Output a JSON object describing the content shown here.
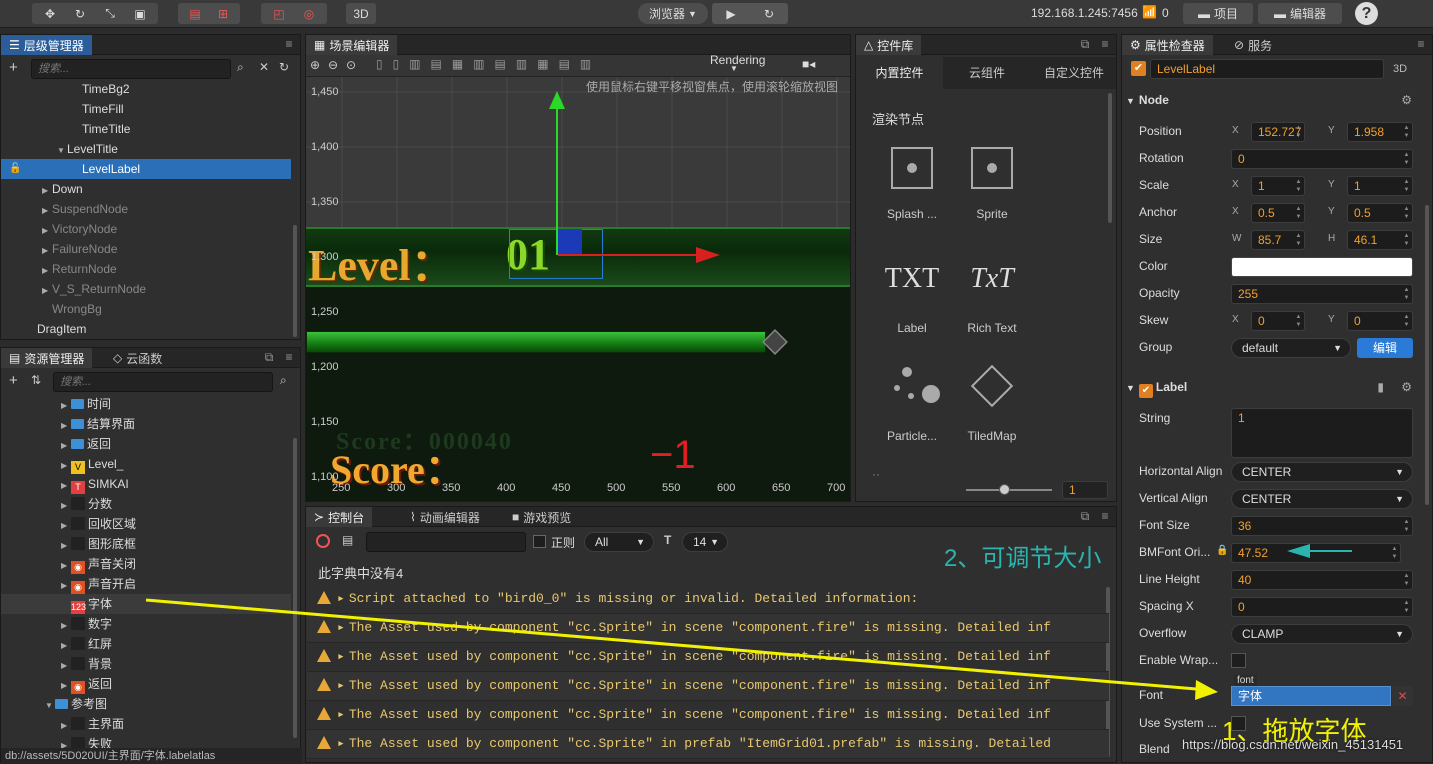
{
  "toolbar": {
    "browser_label": "浏览器",
    "three_d": "3D",
    "ip": "192.168.1.245:7456",
    "wifi_count": "0",
    "project_btn": "项目",
    "editor_btn": "编辑器",
    "help": "?"
  },
  "hierarchy": {
    "tab": "层级管理器",
    "search_placeholder": "搜索...",
    "rows": [
      {
        "label": "TimeBg2",
        "indent": 85,
        "state": "normal",
        "arrow": ""
      },
      {
        "label": "TimeFill",
        "indent": 85,
        "state": "normal",
        "arrow": ""
      },
      {
        "label": "TimeTitle",
        "indent": 85,
        "state": "normal",
        "arrow": ""
      },
      {
        "label": "LevelTitle",
        "indent": 70,
        "state": "normal",
        "arrow": "▼"
      },
      {
        "label": "LevelLabel",
        "indent": 85,
        "state": "selected",
        "arrow": ""
      },
      {
        "label": "Down",
        "indent": 55,
        "state": "normal",
        "arrow": "▶"
      },
      {
        "label": "SuspendNode",
        "indent": 55,
        "state": "dim",
        "arrow": "▶"
      },
      {
        "label": "VictoryNode",
        "indent": 55,
        "state": "dim",
        "arrow": "▶"
      },
      {
        "label": "FailureNode",
        "indent": 55,
        "state": "dim",
        "arrow": "▶"
      },
      {
        "label": "ReturnNode",
        "indent": 55,
        "state": "dim",
        "arrow": "▶"
      },
      {
        "label": "V_S_ReturnNode",
        "indent": 55,
        "state": "dim",
        "arrow": "▶"
      },
      {
        "label": "WrongBg",
        "indent": 55,
        "state": "dim",
        "arrow": ""
      },
      {
        "label": "DragItem",
        "indent": 40,
        "state": "normal",
        "arrow": ""
      }
    ]
  },
  "assets": {
    "tab": "资源管理器",
    "tab2": "云函数",
    "search_placeholder": "搜索...",
    "rows": [
      {
        "label": "时间",
        "icon": "folder",
        "indent": 74
      },
      {
        "label": "结算界面",
        "icon": "folder",
        "indent": 74
      },
      {
        "label": "返回",
        "icon": "folder",
        "indent": 74
      },
      {
        "label": "Level_",
        "icon": "bmfont",
        "indent": 74
      },
      {
        "label": "SIMKAI",
        "icon": "ttf",
        "indent": 74
      },
      {
        "label": "分数",
        "icon": "image",
        "indent": 74
      },
      {
        "label": "回收区域",
        "icon": "image",
        "indent": 74
      },
      {
        "label": "图形底框",
        "icon": "image",
        "indent": 74
      },
      {
        "label": "声音关闭",
        "icon": "sound",
        "indent": 74
      },
      {
        "label": "声音开启",
        "icon": "sound",
        "indent": 74
      },
      {
        "label": "字体",
        "icon": "labelatlas",
        "indent": 74
      },
      {
        "label": "数字",
        "icon": "image",
        "indent": 74
      },
      {
        "label": "红屏",
        "icon": "image",
        "indent": 74
      },
      {
        "label": "背景",
        "icon": "image",
        "indent": 74
      },
      {
        "label": "返回",
        "icon": "sound",
        "indent": 74
      },
      {
        "label": "参考图",
        "icon": "folder",
        "indent": 58
      },
      {
        "label": "主界面",
        "icon": "image",
        "indent": 74
      },
      {
        "label": "失败",
        "icon": "image",
        "indent": 74
      }
    ],
    "status_path": "db://assets/5D020UI/主界面/字体.labelatlas"
  },
  "scene": {
    "tab": "场景编辑器",
    "rendering": "Rendering",
    "hint": "使用鼠标右键平移视窗焦点，使用滚轮缩放视图",
    "y_ticks": [
      "1,450",
      "1,400",
      "1,350",
      "1,300",
      "1,250",
      "1,200",
      "1,150",
      "1,100"
    ],
    "x_ticks": [
      "250",
      "300",
      "350",
      "400",
      "450",
      "500",
      "550",
      "600",
      "650",
      "700"
    ],
    "level_text": "Level：",
    "level_num": "01",
    "score_text": "Score：",
    "score_ghost": "Score：000040",
    "minus": "−1"
  },
  "widgets": {
    "tab": "控件库",
    "tabs": [
      "内置控件",
      "云组件",
      "自定义控件"
    ],
    "section": "渲染节点",
    "items": [
      {
        "label": "Splash ..."
      },
      {
        "label": "Sprite"
      },
      {
        "label": "Label",
        "glyph": "TXT"
      },
      {
        "label": "Rich Text",
        "glyph": "TxT"
      },
      {
        "label": "Particle..."
      },
      {
        "label": "TiledMap"
      }
    ],
    "zoom_value": "1"
  },
  "console": {
    "tabs": [
      "控制台",
      "动画编辑器",
      "游戏预览"
    ],
    "regex_label": "正则",
    "filter": "All",
    "font_size": "14",
    "first_line": "此字典中没有4",
    "warnings": [
      "Script attached to \"bird0_0\" is missing or invalid. Detailed information:",
      "The Asset used by component \"cc.Sprite\" in scene \"component.fire\" is missing. Detailed inf",
      "The Asset used by component \"cc.Sprite\" in scene \"component.fire\" is missing. Detailed inf",
      "The Asset used by component \"cc.Sprite\" in scene \"component.fire\" is missing. Detailed inf",
      "The Asset used by component \"cc.Sprite\" in scene \"component.fire\" is missing. Detailed inf",
      "The Asset used by component \"cc.Sprite\" in prefab \"ItemGrid01.prefab\" is missing. Detailed"
    ]
  },
  "inspector": {
    "tab": "属性检查器",
    "tab2": "服务",
    "node_name": "LevelLabel",
    "three_d": "3D",
    "node_section": "Node",
    "position": {
      "label": "Position",
      "x": "152.727",
      "y": "1.958"
    },
    "rotation": {
      "label": "Rotation",
      "value": "0"
    },
    "scale": {
      "label": "Scale",
      "x": "1",
      "y": "1"
    },
    "anchor": {
      "label": "Anchor",
      "x": "0.5",
      "y": "0.5"
    },
    "size": {
      "label": "Size",
      "w": "85.7",
      "h": "46.1"
    },
    "color": {
      "label": "Color",
      "value": "#ffffff"
    },
    "opacity": {
      "label": "Opacity",
      "value": "255"
    },
    "skew": {
      "label": "Skew",
      "x": "0",
      "y": "0"
    },
    "group": {
      "label": "Group",
      "value": "default",
      "edit": "编辑"
    },
    "label_section": "Label",
    "string": {
      "label": "String",
      "value": "1"
    },
    "halign": {
      "label": "Horizontal Align",
      "value": "CENTER"
    },
    "valign": {
      "label": "Vertical Align",
      "value": "CENTER"
    },
    "font_size": {
      "label": "Font Size",
      "value": "36"
    },
    "bmfont": {
      "label": "BMFont Ori...",
      "value": "47.52"
    },
    "line_height": {
      "label": "Line Height",
      "value": "40"
    },
    "spacing": {
      "label": "Spacing X",
      "value": "0"
    },
    "overflow": {
      "label": "Overflow",
      "value": "CLAMP"
    },
    "wrap": {
      "label": "Enable Wrap..."
    },
    "font": {
      "label": "Font",
      "tag": "font",
      "value": "字体"
    },
    "system": {
      "label": "Use System ..."
    },
    "blend": {
      "label": "Blend"
    }
  },
  "annotations": {
    "note1": "1、拖放字体",
    "note2": "2、可调节大小",
    "watermark": "https://blog.csdn.net/weixin_45131451"
  },
  "colors": {
    "accent": "#2a6fb7",
    "orange": "#f0a030",
    "arrow": "#f2f200",
    "teal": "#2ab5b0"
  }
}
